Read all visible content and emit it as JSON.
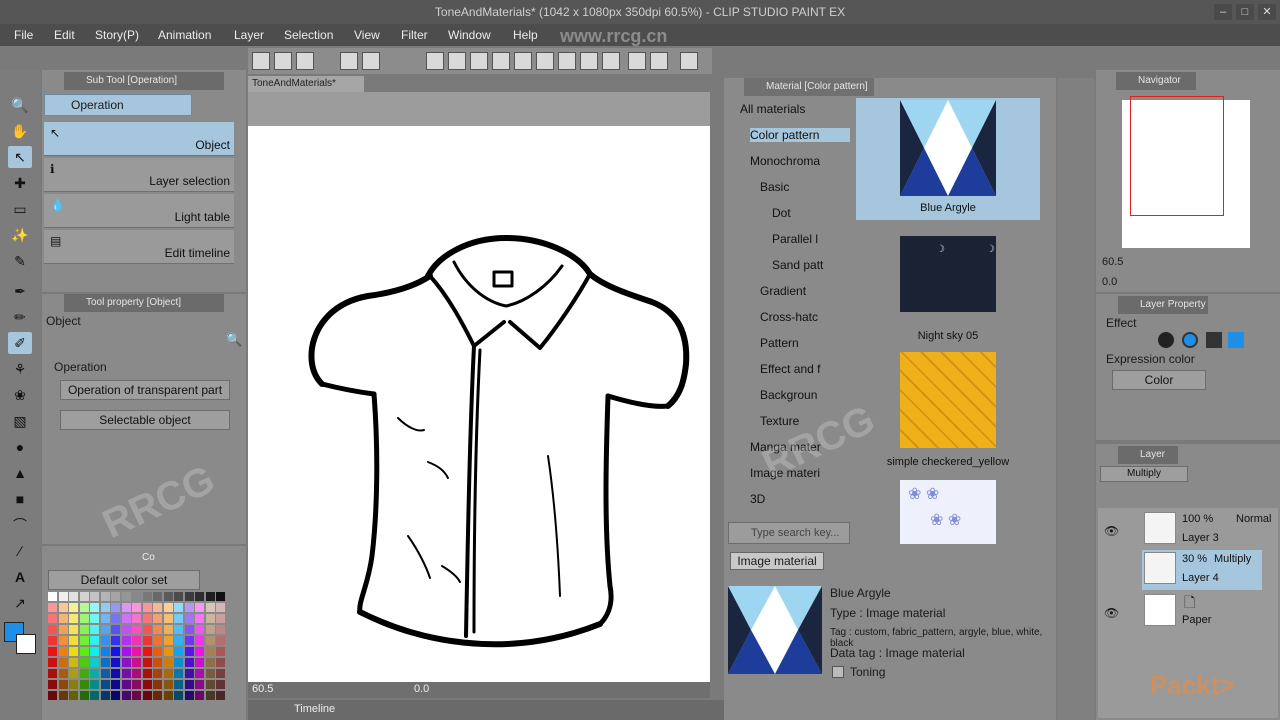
{
  "window": {
    "title": "ToneAndMaterials* (1042 x 1080px 350dpi 60.5%) - CLIP STUDIO PAINT EX",
    "watermark_url": "www.rrcg.cn"
  },
  "menu": [
    "File",
    "Edit",
    "Story(P)",
    "Animation",
    "Layer",
    "Selection",
    "View",
    "Filter",
    "Window",
    "Help"
  ],
  "subtool_panel": {
    "title": "Sub Tool [Operation]",
    "tab": "Operation",
    "items": [
      "Object",
      "Layer selection",
      "Light table",
      "Edit timeline"
    ]
  },
  "tool_property": {
    "title": "Tool property [Object]",
    "name": "Object",
    "section": "Operation",
    "dropdown1": "Operation of transparent part",
    "dropdown2": "Selectable object"
  },
  "color_set": {
    "tab_label": "Co",
    "selected": "Default color set"
  },
  "document": {
    "tab": "ToneAndMaterials*",
    "zoom": "60.5",
    "angle": "0.0"
  },
  "timeline_label": "Timeline",
  "material_panel": {
    "title": "Material [Color pattern]",
    "tree": [
      "All materials",
      "Color pattern",
      "Monochroma",
      "Basic",
      "Dot",
      "Parallel l",
      "Sand patt",
      "Gradient",
      "Cross-hatc",
      "Pattern",
      "Effect and f",
      "Backgroun",
      "Texture",
      "Manga mater",
      "Image materi",
      "3D"
    ],
    "thumbnails": [
      "Blue Argyle",
      "Night sky 05",
      "simple checkered_yellow"
    ],
    "search_placeholder": "Type search key...",
    "tab": "Image material",
    "detail": {
      "name": "Blue Argyle",
      "type": "Type : Image material",
      "tags": "Tag : custom, fabric_pattern, argyle, blue, white, black",
      "data_tag": "Data tag : Image material",
      "toning": "Toning"
    }
  },
  "navigator": {
    "title": "Navigator",
    "zoom": "60.5",
    "angle": "0.0"
  },
  "layer_property": {
    "title": "Layer Property",
    "effect": "Effect",
    "expression_color_label": "Expression color",
    "expression_color": "Color"
  },
  "layers_panel": {
    "title": "Layer",
    "blend_mode": "Multiply",
    "layers": [
      {
        "opacity": "100 %",
        "mode": "Normal",
        "name": "Layer 3"
      },
      {
        "opacity": "30 %",
        "mode": "Multiply",
        "name": "Layer 4"
      },
      {
        "opacity": "",
        "mode": "",
        "name": "Paper"
      }
    ]
  },
  "brand": "Packt>",
  "colors": {
    "main_color": "#1e8fe8",
    "accent_selected": "#a6c6de",
    "panel_bg": "#8a8a8a",
    "title_bg": "#565656"
  },
  "icons": [
    "zoom-icon",
    "hand-icon",
    "operation-icon",
    "move-layer-icon",
    "selection-icon",
    "auto-select-icon",
    "eyedropper-icon",
    "pen-icon",
    "pencil-icon",
    "brush-icon",
    "airbrush-icon",
    "decoration-icon",
    "eraser-icon",
    "blend-icon",
    "fill-icon",
    "gradient-icon",
    "figure-icon",
    "frame-icon",
    "text-icon",
    "balloon-icon",
    "correct-line-icon"
  ]
}
